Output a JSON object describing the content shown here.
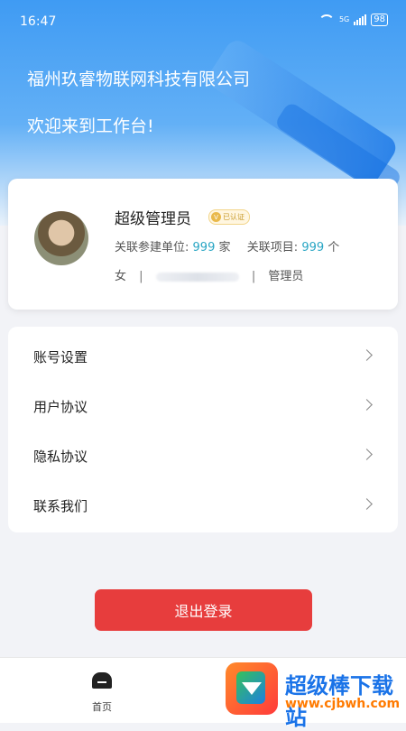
{
  "status_bar": {
    "time": "16:47",
    "network": "5G",
    "battery": "98"
  },
  "header": {
    "company": "福州玖睿物联网科技有限公司",
    "welcome": "欢迎来到工作台!"
  },
  "profile": {
    "name": "超级管理员",
    "badge": "已认证",
    "stats_label_units": "关联参建单位:",
    "stats_units_value": "999",
    "stats_units_suffix": "家",
    "stats_label_projects": "关联项目:",
    "stats_projects_value": "999",
    "stats_projects_suffix": "个",
    "gender": "女",
    "separator": "|",
    "role": "管理员"
  },
  "menu": {
    "items": [
      {
        "label": "账号设置"
      },
      {
        "label": "用户协议"
      },
      {
        "label": "隐私协议"
      },
      {
        "label": "联系我们"
      }
    ]
  },
  "actions": {
    "logout_label": "退出登录"
  },
  "tabbar": {
    "home_label": "首页"
  },
  "watermark": {
    "title": "超级棒下载站",
    "url": "www.cjbwh.com"
  },
  "colors": {
    "accent_blue": "#3f9bf3",
    "logout_red": "#e73d3d",
    "number_teal": "#2aa6c4"
  }
}
